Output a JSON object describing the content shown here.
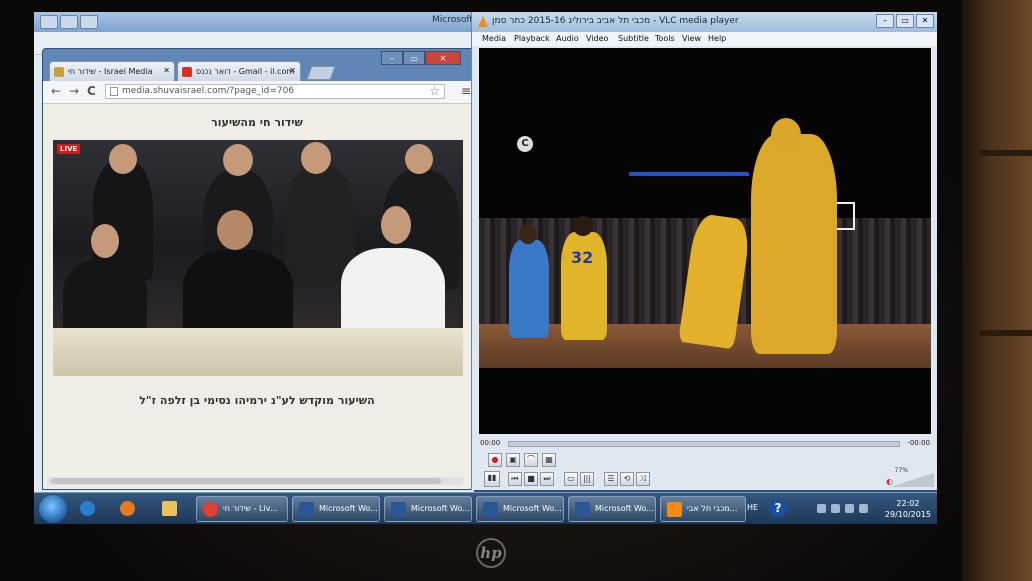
{
  "bg_window": {
    "title": "Microsoft"
  },
  "chrome": {
    "tabs": [
      {
        "label": "שידור חי - Israel Media",
        "favicon_color": "#c4a23a"
      },
      {
        "label": "דואר נכנס - Gmail - il.com",
        "favicon_color": "#d93025"
      }
    ],
    "window_controls": [
      "–",
      "▭",
      "✕"
    ],
    "back_icon": "←",
    "forward_icon": "→",
    "reload_icon": "C",
    "url": "media.shuvaisrael.com/?page_id=706",
    "star_icon": "☆",
    "menu_icon": "≡",
    "page_title": "שידור חי מהשיעור",
    "live_badge": "LIVE",
    "caption": "השיעור מוקדש לע\"נ ירמיהו נסימי בן זלפה ז\"ל"
  },
  "vlc": {
    "title": "מכבי תל אביב בירוליג 2015-16 כתר סמן - VLC media player",
    "window_controls": [
      "–",
      "▭",
      "✕"
    ],
    "menu": [
      "Media",
      "Playback",
      "Audio",
      "Video",
      "Subtitle",
      "Tools",
      "View",
      "Help"
    ],
    "time_elapsed": "00:00",
    "time_remaining": "-00:00",
    "channel_logo": "C",
    "jersey_number": "32",
    "volume_percent": "77%",
    "controls_row1": [
      "●",
      "▣",
      "⌒",
      "▦"
    ],
    "controls_row2": [
      "▮▮",
      "⏮",
      "■",
      "⏭",
      "▭",
      "|||",
      "☰",
      "⟲",
      "⤨"
    ]
  },
  "taskbar": {
    "items": [
      {
        "label": "שידור חי - Liv...",
        "icon_color": "#e0402f"
      },
      {
        "label": "Microsoft Wo...",
        "icon_color": "#2b5797"
      },
      {
        "label": "Microsoft Wo...",
        "icon_color": "#2b5797"
      },
      {
        "label": "Microsoft Wo...",
        "icon_color": "#2b5797"
      },
      {
        "label": "Microsoft Wo...",
        "icon_color": "#2b5797"
      },
      {
        "label": "מכבי תל אבי...",
        "icon_color": "#f28c16"
      }
    ],
    "lang": "HE",
    "help_icon": "?",
    "time": "22:02",
    "date": "29/10/2015"
  },
  "brand_logo": "hp"
}
